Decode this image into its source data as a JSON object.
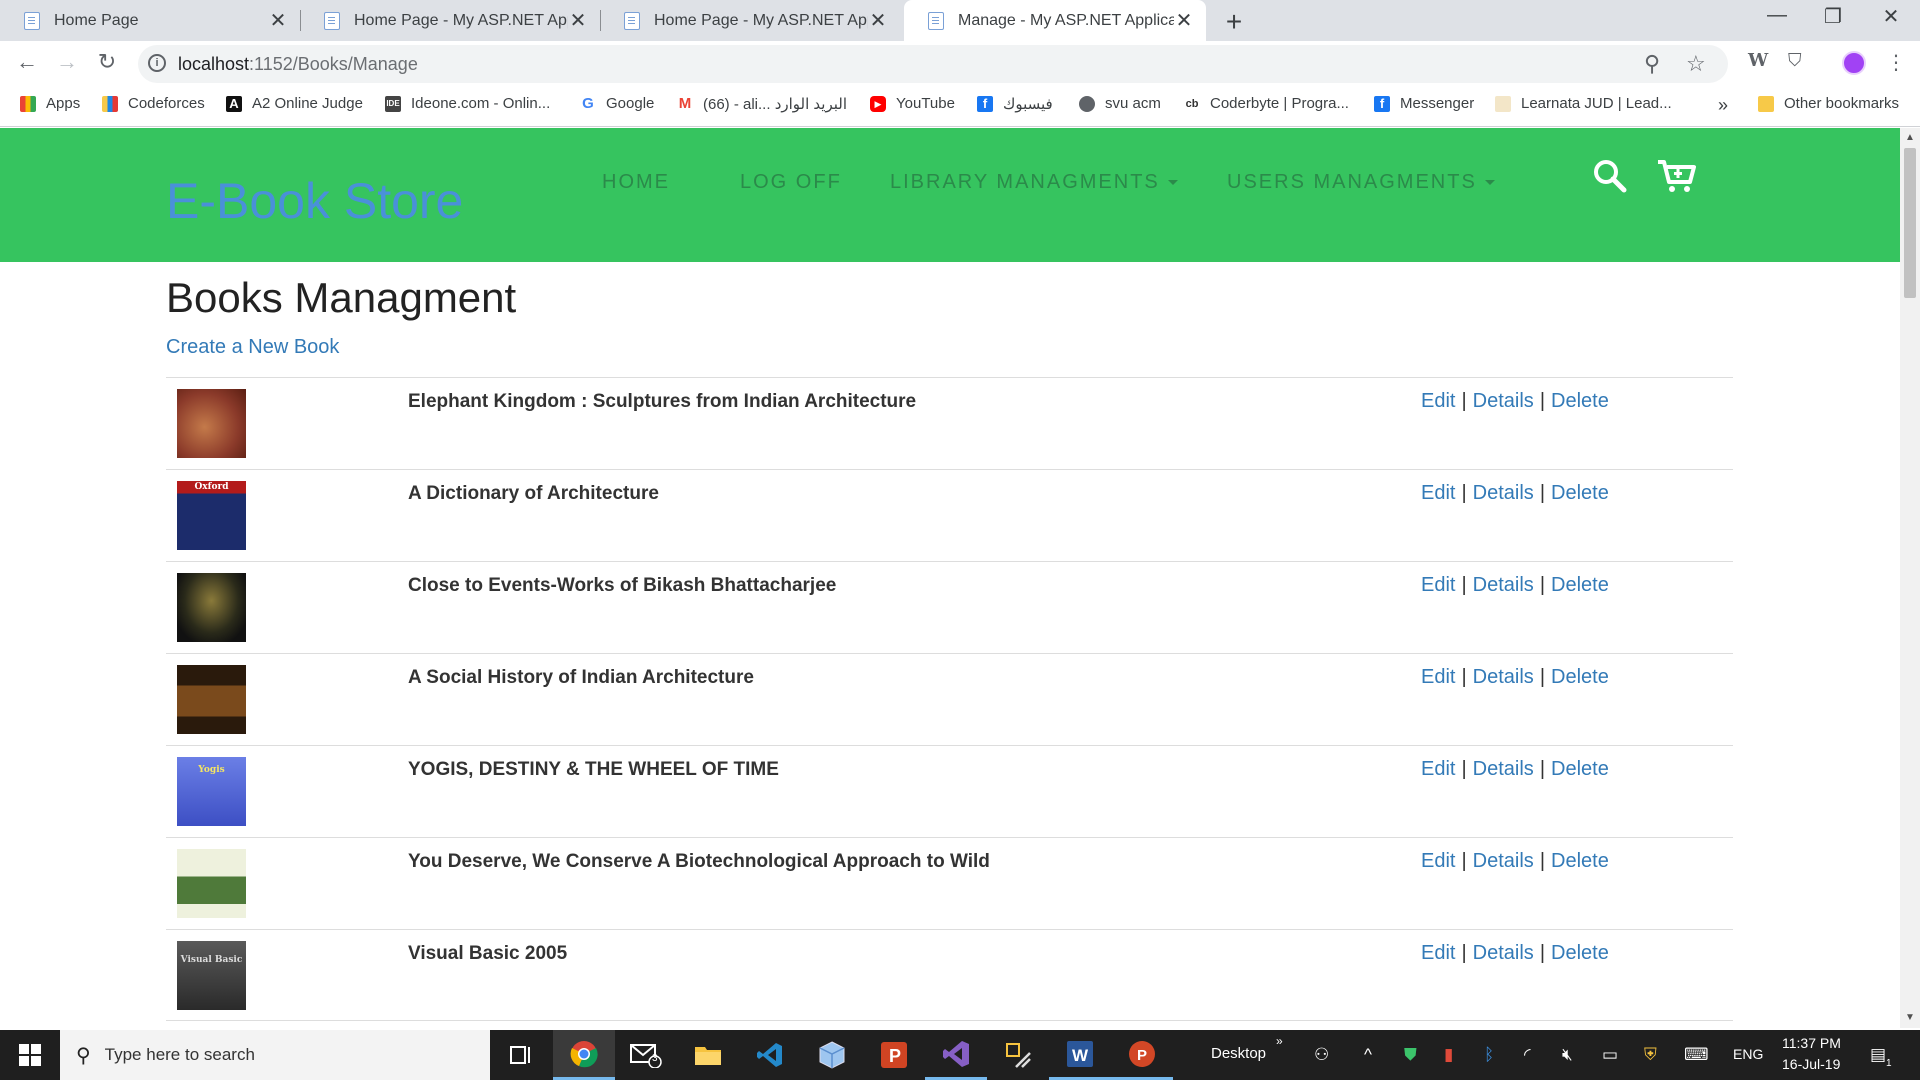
{
  "browser": {
    "tabs": [
      {
        "label": "Home Page",
        "active": false
      },
      {
        "label": "Home Page - My ASP.NET Applic",
        "active": false
      },
      {
        "label": "Home Page - My ASP.NET Applic",
        "active": false
      },
      {
        "label": "Manage - My ASP.NET Applicatio",
        "active": true
      }
    ],
    "url_host": "localhost",
    "url_path": ":1152/Books/Manage",
    "extension_label": "W",
    "bookmarks": [
      {
        "label": "Apps",
        "icon": "apps-grid-icon"
      },
      {
        "label": "Codeforces",
        "icon": "codeforces-icon"
      },
      {
        "label": "A2 Online Judge",
        "icon": "a2-icon"
      },
      {
        "label": "Ideone.com - Onlin...",
        "icon": "ideone-icon"
      },
      {
        "label": "Google",
        "icon": "google-icon"
      },
      {
        "label": "(66) - ali... البريد الوارد",
        "icon": "gmail-icon"
      },
      {
        "label": "YouTube",
        "icon": "youtube-icon"
      },
      {
        "label": "فيسبوك",
        "icon": "facebook-icon"
      },
      {
        "label": "svu acm",
        "icon": "globe-icon"
      },
      {
        "label": "Coderbyte | Progra...",
        "icon": "coderbyte-icon"
      },
      {
        "label": "Messenger",
        "icon": "facebook-icon"
      },
      {
        "label": "Learnata JUD | Lead...",
        "icon": "learnata-icon"
      }
    ],
    "bookmarks_overflow": "»",
    "other_bookmarks": "Other bookmarks"
  },
  "site": {
    "brand": "E-Book Store",
    "nav": [
      {
        "label": "HOME",
        "dropdown": false
      },
      {
        "label": "LOG OFF",
        "dropdown": false
      },
      {
        "label": "LIBRARY MANAGMENTS",
        "dropdown": true
      },
      {
        "label": "USERS MANAGMENTS",
        "dropdown": true
      }
    ],
    "colors": {
      "navbar": "#36c45f",
      "brand": "#4a90d9",
      "link": "#337ab7"
    }
  },
  "page": {
    "title": "Books Managment",
    "create_link": "Create a New Book",
    "actions": {
      "edit": "Edit",
      "details": "Details",
      "delete": "Delete",
      "separator": "|"
    },
    "books": [
      {
        "title": "Elephant Kingdom : Sculptures from Indian Architecture",
        "cover_color": "#8b3a2a"
      },
      {
        "title": "A Dictionary of Architecture",
        "cover_color": "#1c2c6b",
        "cover_text": "Oxford"
      },
      {
        "title": "Close to Events-Works of Bikash Bhattacharjee",
        "cover_color": "#2a2a1a"
      },
      {
        "title": "A Social History of Indian Architecture",
        "cover_color": "#4a2c12"
      },
      {
        "title": "YOGIS, DESTINY & THE WHEEL OF TIME",
        "cover_color": "#4d63d8",
        "cover_text": "Yogis"
      },
      {
        "title": "You Deserve, We Conserve A Biotechnological Approach to Wild",
        "cover_color": "#e9edd8"
      },
      {
        "title": "Visual Basic 2005",
        "cover_color": "#3b3b3b",
        "cover_text": "Visual Basic"
      }
    ]
  },
  "taskbar": {
    "search_placeholder": "Type here to search",
    "desktop_label": "Desktop",
    "mail_badge": "3",
    "language": "ENG",
    "time": "11:37 PM",
    "date": "16-Jul-19",
    "notification_count": "1"
  }
}
